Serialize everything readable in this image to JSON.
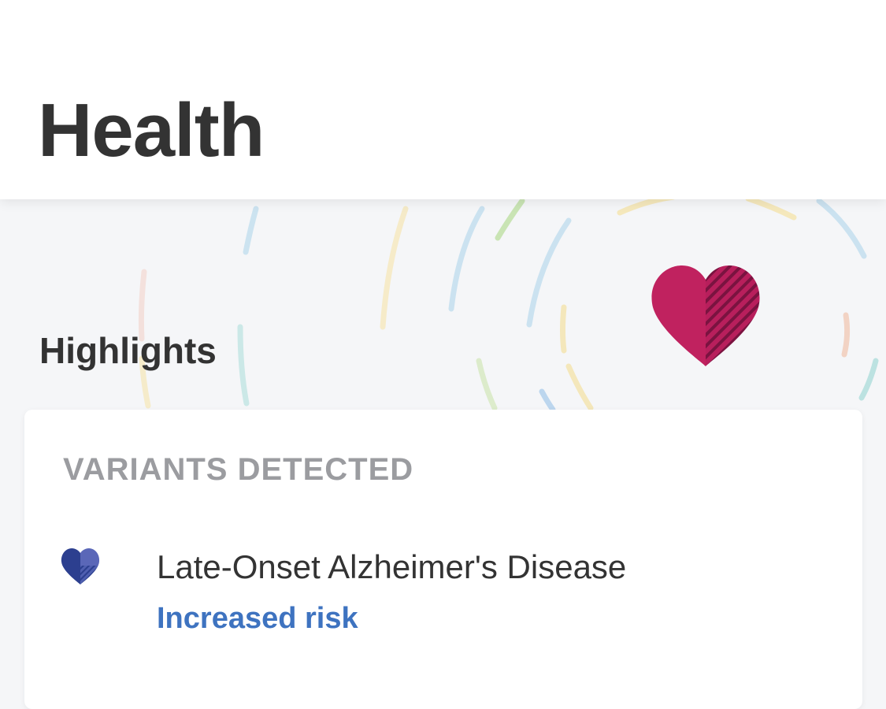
{
  "header": {
    "title": "Health"
  },
  "hero": {
    "icon": "heart-icon",
    "heart_color": "#c0225f"
  },
  "highlights": {
    "title": "Highlights",
    "card": {
      "label": "VARIANTS DETECTED",
      "variants": [
        {
          "name": "Late-Onset Alzheimer's Disease",
          "status": "Increased risk",
          "icon": "heart-icon",
          "icon_color": "#2c3f8f",
          "status_color": "#3e73c0"
        }
      ]
    }
  }
}
